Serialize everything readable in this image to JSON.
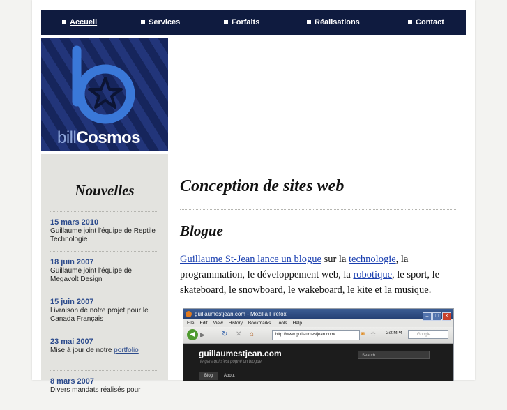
{
  "nav": {
    "items": [
      {
        "label": "Accueil",
        "active": true
      },
      {
        "label": "Services",
        "active": false
      },
      {
        "label": "Forfaits",
        "active": false
      },
      {
        "label": "Réalisations",
        "active": false
      },
      {
        "label": "Contact",
        "active": false
      }
    ]
  },
  "logo": {
    "prefix": "bill",
    "name": "Cosmos",
    "letter": "b"
  },
  "sidebar": {
    "title": "Nouvelles",
    "news": [
      {
        "date": "15 mars 2010",
        "text": "Guillaume joint l'équipe de Reptile Technologie",
        "link": ""
      },
      {
        "date": "18 juin 2007",
        "text": "Guillaume joint l'équipe de Megavolt Design",
        "link": ""
      },
      {
        "date": "15 juin 2007",
        "text": "Livraison de notre projet pour le Canada Français",
        "link": ""
      },
      {
        "date": "23 mai 2007",
        "text": "Mise à jour de notre ",
        "link": "portfolio"
      },
      {
        "date": "8 mars 2007",
        "text": "Divers mandats réalisés pour",
        "link": ""
      }
    ]
  },
  "main": {
    "title": "Conception de sites web",
    "section_title": "Blogue",
    "paragraph": {
      "link1": "Guillaume St-Jean lance un blogue",
      "t1": " sur la ",
      "link2": "technologie",
      "t2": ", la programmation, le développement web, la ",
      "link3": "robotique",
      "t3": ", le sport, le skateboard, le snowboard, le wakeboard, le kite et la musique."
    }
  },
  "screenshot": {
    "window_title": "guillaumestjean.com - Mozilla Firefox",
    "menu": [
      "File",
      "Edit",
      "View",
      "History",
      "Bookmarks",
      "Tools",
      "Help"
    ],
    "url": "http://www.guillaumestjean.com/",
    "getmp4": "Get MP4",
    "search_placeholder": "Google",
    "site_name": "guillaumestjean.com",
    "site_tagline": "le gars qui s'est pogné un blogue",
    "site_search": "Search",
    "tabs": [
      "Blog",
      "About"
    ]
  },
  "colors": {
    "nav_bg": "#0f1b3f",
    "link": "#1a3fb0",
    "news_date": "#2b4a8c",
    "sidebar_bg": "#e3e3df"
  }
}
